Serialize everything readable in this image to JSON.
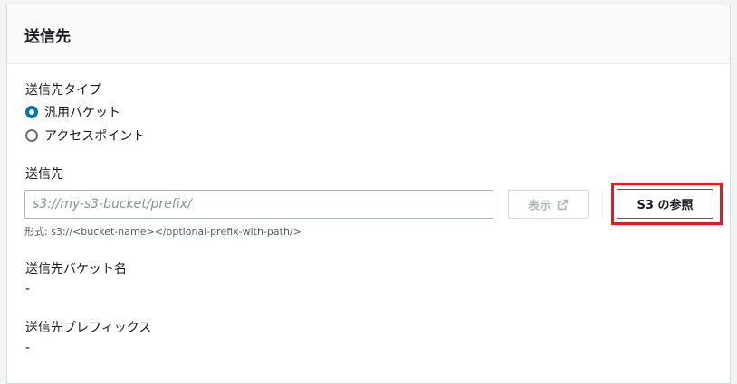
{
  "panel": {
    "title": "送信先"
  },
  "destination_type": {
    "label": "送信先タイプ",
    "options": [
      {
        "label": "汎用バケット",
        "selected": true
      },
      {
        "label": "アクセスポイント",
        "selected": false
      }
    ]
  },
  "destination": {
    "label": "送信先",
    "input_value": "",
    "input_placeholder": "s3://my-s3-bucket/prefix/",
    "hint": "形式: s3://<bucket-name></optional-prefix-with-path/>",
    "view_button": "表示",
    "view_icon": "external-link-icon",
    "browse_button": "S3 の参照"
  },
  "bucket_name": {
    "label": "送信先バケット名",
    "value": "-"
  },
  "prefix": {
    "label": "送信先プレフィックス",
    "value": "-"
  },
  "colors": {
    "accent": "#0073bb",
    "highlight": "#e01b24"
  }
}
